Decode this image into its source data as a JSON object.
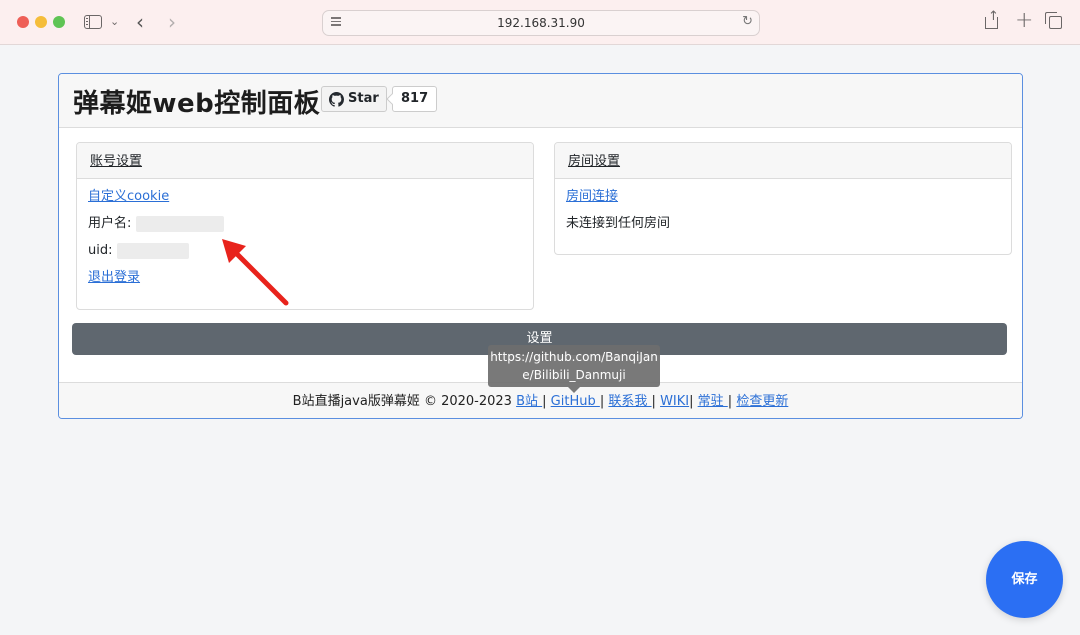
{
  "browser": {
    "address": "192.168.31.90",
    "back_glyph": "‹",
    "forward_glyph": "›",
    "reload_glyph": "↻",
    "plus_glyph": "+",
    "chevron_glyph": "⌄"
  },
  "header": {
    "title": "弹幕姬web控制面板",
    "star_label": "Star",
    "star_count": "817"
  },
  "account_card": {
    "title": "账号设置",
    "custom_cookie": "自定义cookie",
    "username_label": "用户名:",
    "uid_label": "uid:",
    "logout": "退出登录"
  },
  "room_card": {
    "title": "房间设置",
    "connect_link": "房间连接",
    "status": "未连接到任何房间"
  },
  "settings_button": "设置",
  "tooltip": {
    "line1": "https://github.com/BanqiJan",
    "line2": "e/Bilibili_Danmuji"
  },
  "footer": {
    "text": "B站直播java版弹幕姬 © 2020-2023 ",
    "links": [
      "B站 ",
      "GitHub ",
      "联系我 ",
      "WIKI",
      "常驻 ",
      "检查更新"
    ],
    "sep": "|"
  },
  "save_button": "保存",
  "colors": {
    "accent": "#2b6ff3",
    "panel_border": "#5b8fe0",
    "annotation_arrow": "#e8231c"
  }
}
